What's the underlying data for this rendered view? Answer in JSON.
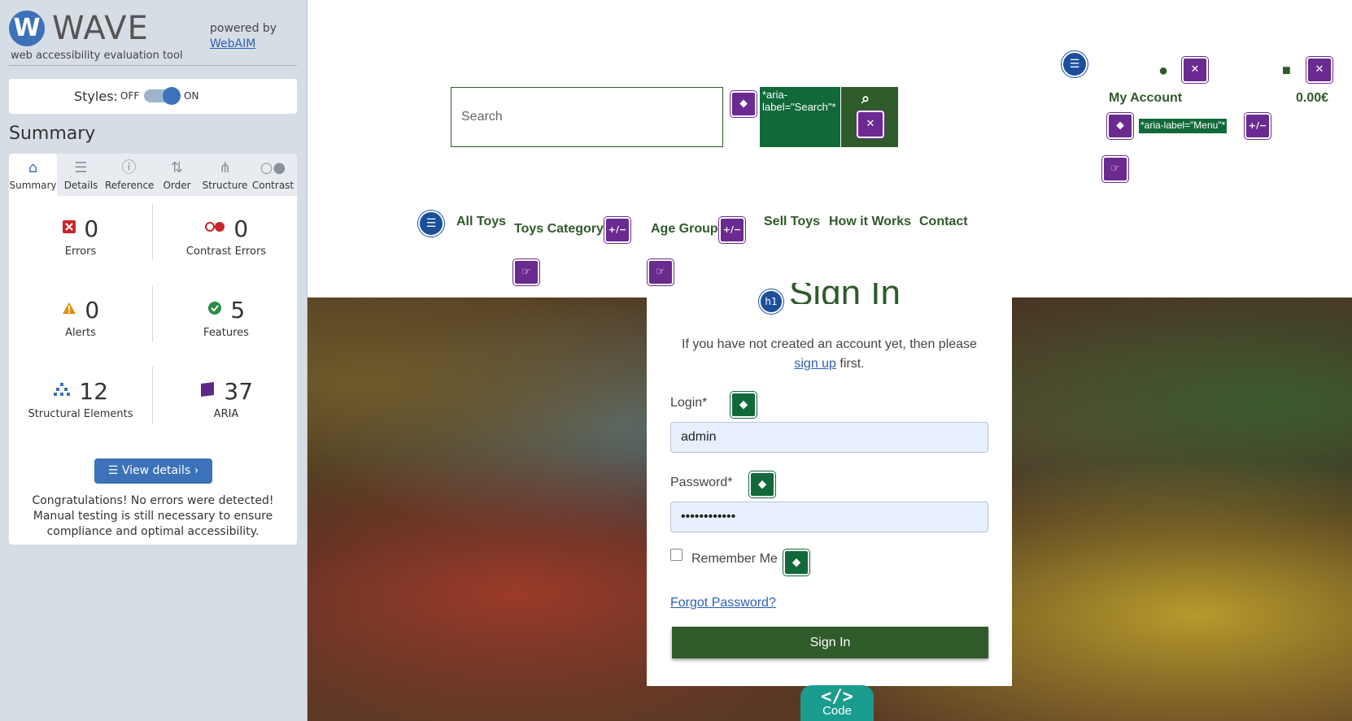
{
  "wave": {
    "logo_letter": "W",
    "title": "WAVE",
    "subtitle": "web accessibility evaluation tool",
    "powered_by": "powered by",
    "webaim_link": "WebAIM",
    "styles_label": "Styles:",
    "styles_off": "OFF",
    "styles_on": "ON",
    "summary_heading": "Summary",
    "tabs": [
      {
        "label": "Summary",
        "icon": "home-icon",
        "glyph": "⌂"
      },
      {
        "label": "Details",
        "icon": "list-icon",
        "glyph": "☰"
      },
      {
        "label": "Reference",
        "icon": "info-icon",
        "glyph": "ⓘ"
      },
      {
        "label": "Order",
        "icon": "order-icon",
        "glyph": "⇅"
      },
      {
        "label": "Structure",
        "icon": "structure-icon",
        "glyph": "⋔"
      },
      {
        "label": "Contrast",
        "icon": "contrast-icon",
        "glyph": "○●"
      }
    ],
    "stats": {
      "errors": {
        "value": "0",
        "label": "Errors",
        "color": "#c8262b"
      },
      "contrast_errors": {
        "value": "0",
        "label": "Contrast Errors",
        "color": "#c8262b"
      },
      "alerts": {
        "value": "0",
        "label": "Alerts",
        "color": "#e58a00"
      },
      "features": {
        "value": "5",
        "label": "Features",
        "color": "#2c8a4a"
      },
      "structural": {
        "value": "12",
        "label": "Structural Elements",
        "color": "#3b72b9"
      },
      "aria": {
        "value": "37",
        "label": "ARIA",
        "color": "#5b2a86"
      }
    },
    "view_details": "View details ›",
    "congrats": "Congratulations! No errors were detected! Manual testing is still necessary to ensure compliance and optimal accessibility."
  },
  "site": {
    "search_placeholder": "Search",
    "search_aria_label": "*aria-label=\"Search\"*",
    "my_account": "My Account",
    "cart_total": "0.00€",
    "menu_aria_label": "*aria-label=\"Menu\"*",
    "nav": [
      "All Toys",
      "Toys Category",
      "Age Group",
      "Sell Toys",
      "How it Works",
      "Contact"
    ],
    "signin": {
      "title": "Sign In",
      "h1_badge": "h1",
      "intro_before": "If you have not created an account yet, then please",
      "signup_link": "sign up",
      "intro_after": "first.",
      "login_label": "Login*",
      "login_value": "admin",
      "password_label": "Password*",
      "password_value": "••••••••••••",
      "remember_label": "Remember Me",
      "forgot_link": "Forgot Password?",
      "submit": "Sign In"
    },
    "code_tab": {
      "glyph": "</>",
      "label": "Code"
    }
  }
}
